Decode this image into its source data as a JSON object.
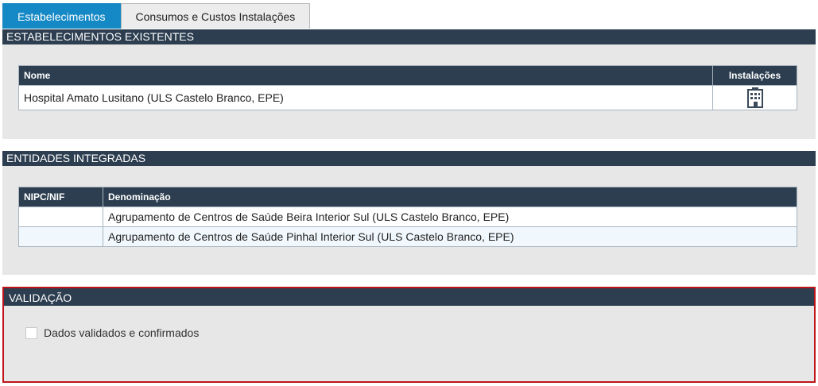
{
  "tabs": [
    {
      "label": "Estabelecimentos",
      "active": true
    },
    {
      "label": "Consumos e Custos Instalações",
      "active": false
    }
  ],
  "estabelecimentos": {
    "header": "ESTABELECIMENTOS EXISTENTES",
    "columns": [
      "Nome",
      "Instalações"
    ],
    "rows": [
      {
        "nome": "Hospital Amato Lusitano (ULS Castelo Branco, EPE)",
        "icon": "building-icon"
      }
    ]
  },
  "entidades": {
    "header": "ENTIDADES INTEGRADAS",
    "columns": [
      "NIPC/NIF",
      "Denominação"
    ],
    "rows": [
      {
        "nif": "",
        "denominacao": "Agrupamento de Centros de Saúde Beira Interior Sul (ULS Castelo Branco, EPE)"
      },
      {
        "nif": "",
        "denominacao": "Agrupamento de Centros de Saúde Pinhal Interior Sul (ULS Castelo Branco, EPE)"
      }
    ]
  },
  "validacao": {
    "header": "VALIDAÇÃO",
    "checkbox_label": "Dados validados e confirmados",
    "checked": false
  },
  "colors": {
    "tab_active": "#1589c5",
    "header_bg": "#2c3e50",
    "panel_bg": "#e7e7e7",
    "validation_border": "#c0141b"
  }
}
